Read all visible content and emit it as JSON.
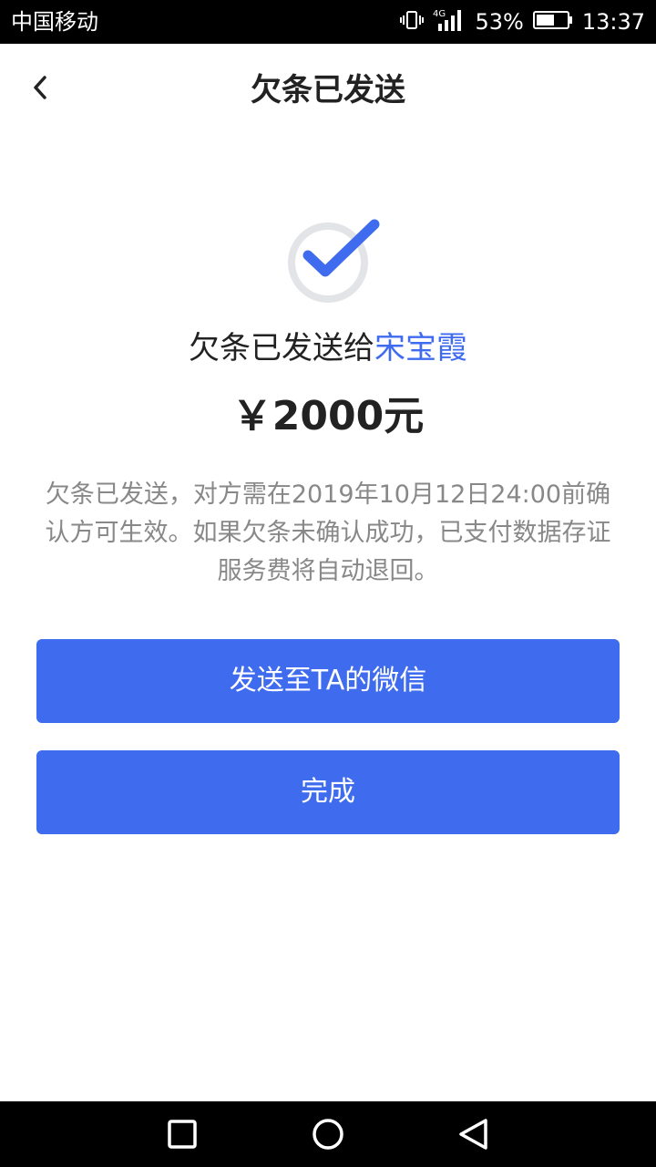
{
  "status_bar": {
    "carrier": "中国移动",
    "network": "4G",
    "battery_percent": "53%",
    "time": "13:37",
    "icons": [
      "vibrate-icon",
      "signal-icon",
      "battery-icon"
    ]
  },
  "header": {
    "title": "欠条已发送",
    "back_icon": "chevron-left-icon"
  },
  "result": {
    "icon": "check-circle-icon",
    "sent_to_prefix": "欠条已发送给",
    "recipient": "宋宝霞",
    "amount": "￥2000元",
    "notice": "欠条已发送，对方需在2019年10月12日24:00前确认方可生效。如果欠条未确认成功，已支付数据存证服务费将自动退回。"
  },
  "actions": {
    "send_wechat_label": "发送至TA的微信",
    "done_label": "完成"
  },
  "colors": {
    "accent": "#3f6bef",
    "text_primary": "#222222",
    "text_secondary": "#888888",
    "check_ring": "#e3e4e8"
  },
  "nav_bar": {
    "icons": [
      "recent-apps-icon",
      "home-icon",
      "back-triangle-icon"
    ]
  }
}
